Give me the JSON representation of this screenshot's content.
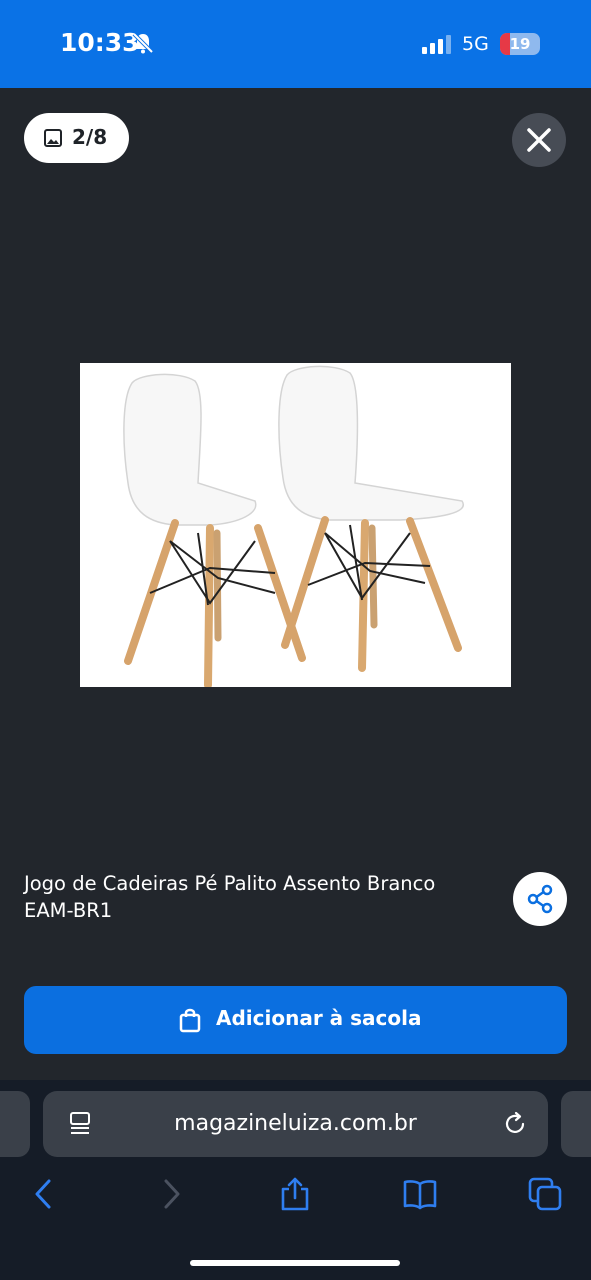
{
  "status_bar": {
    "time": "10:33",
    "network": "5G",
    "battery": "19"
  },
  "gallery": {
    "counter": "2/8"
  },
  "product": {
    "title": "Jogo de Cadeiras Pé Palito Assento Branco EAM-BR1",
    "image_alt": "Duas cadeiras brancas com pés palito de madeira"
  },
  "cta": {
    "label": "Adicionar à sacola"
  },
  "browser": {
    "url": "magazineluiza.com.br"
  },
  "colors": {
    "status_bar": "#0a72e6",
    "background": "#22262c",
    "button": "#0b6fe0",
    "browser_bar": "#3a4049"
  }
}
